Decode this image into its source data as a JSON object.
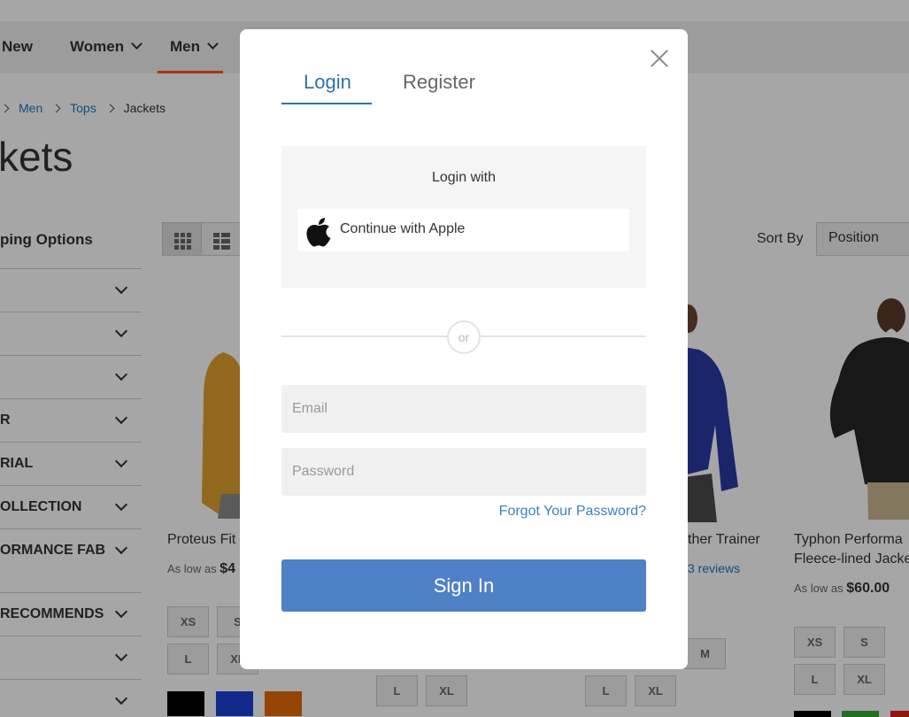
{
  "nav": {
    "items": [
      {
        "label": "New"
      },
      {
        "label": "Women"
      },
      {
        "label": "Men"
      }
    ]
  },
  "breadcrumb": [
    "Men",
    "Tops",
    "Jackets"
  ],
  "page_title": "kets",
  "filters": {
    "title": "ping Options",
    "items": [
      "",
      "",
      "",
      "R",
      "RIAL",
      "OLLECTION",
      "ORMANCE FAB",
      "RECOMMENDS",
      "",
      ""
    ]
  },
  "toolbar": {
    "sort_label": "Sort By",
    "sort_value": "Position"
  },
  "products": [
    {
      "name": "Proteus Fit",
      "price_prefix": "As low as",
      "price": "$4"
    },
    {
      "name": "ther Trainer",
      "reviews": "3 reviews"
    },
    {
      "name": "Typhon Performa",
      "name2": "Fleece-lined Jacke",
      "price_prefix": "As low as",
      "price": "$60.00"
    }
  ],
  "sizes": [
    "XS",
    "S",
    "M",
    "L",
    "XL"
  ],
  "colors": {
    "brand_orange": "#ff5501",
    "link_blue": "#1979c3",
    "signin_blue": "#4f81c6",
    "swatch_black": "#000000",
    "swatch_blue": "#1a3fd6",
    "swatch_orange": "#e36a0a",
    "swatch_green": "#3aa839",
    "swatch_red": "#e0231c"
  },
  "modal": {
    "tabs": {
      "login": "Login",
      "register": "Register"
    },
    "social": {
      "title": "Login with",
      "apple_label": "Continue with Apple"
    },
    "divider_text": "or",
    "email_placeholder": "Email",
    "password_placeholder": "Password",
    "forgot_link": "Forgot Your Password?",
    "signin_label": "Sign In"
  }
}
